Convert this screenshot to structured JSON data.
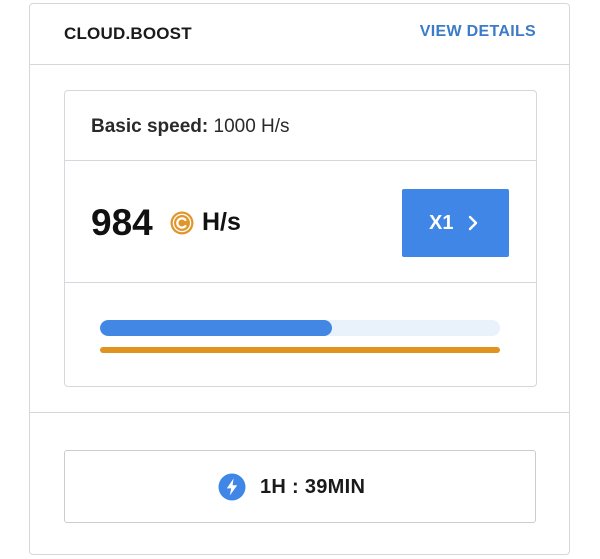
{
  "header": {
    "brand": "CLOUD.BOOST",
    "details_link": "VIEW DETAILS"
  },
  "speed": {
    "basic_label": "Basic speed:",
    "basic_value": "1000 H/s",
    "current_value": "984",
    "unit": "H/s",
    "coin_icon": "coin-c-icon",
    "multiplier_label": "X1",
    "chevron_icon": "chevron-right-icon"
  },
  "progress": {
    "fill_fraction": 0.58,
    "fill_color": "#4287e4",
    "track_color": "#e9f1fb",
    "secondary_bar_color": "#e09420"
  },
  "timer": {
    "icon": "lightning-bolt-icon",
    "text": "1H : 39MIN"
  },
  "colors": {
    "accent": "#3f86e6",
    "link": "#3b7bc8",
    "coin": "#e0962a"
  }
}
